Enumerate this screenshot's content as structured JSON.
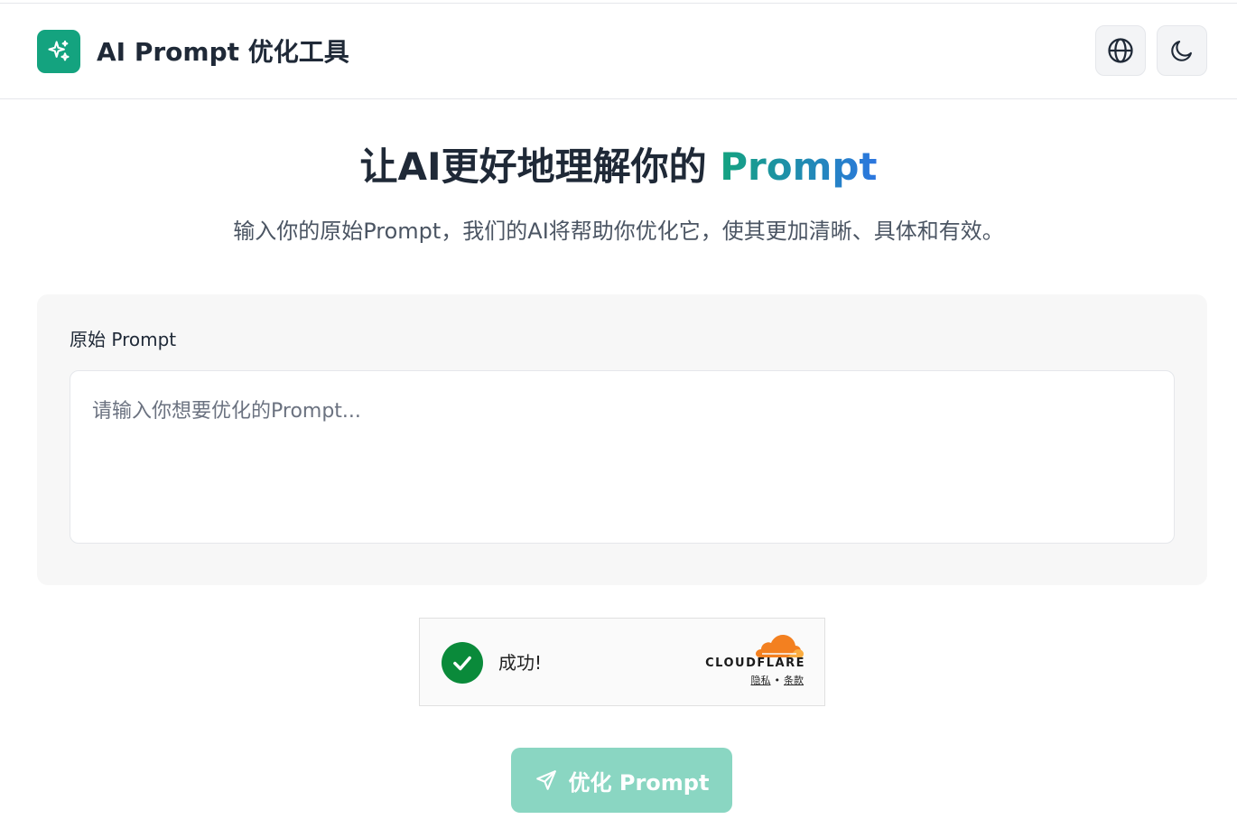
{
  "header": {
    "app_title": "AI Prompt 优化工具",
    "logo_icon": "sparkles-icon",
    "language_button_icon": "globe-icon",
    "theme_button_icon": "moon-icon"
  },
  "hero": {
    "title_main": "让AI更好地理解你的 ",
    "title_accent": "Prompt",
    "subtitle": "输入你的原始Prompt，我们的AI将帮助你优化它，使其更加清晰、具体和有效。"
  },
  "form": {
    "label": "原始 Prompt",
    "input_value": "",
    "input_placeholder": "请输入你想要优化的Prompt..."
  },
  "captcha": {
    "status_text": "成功!",
    "brand": "CLOUDFLARE",
    "privacy_link": "隐私",
    "separator": "•",
    "terms_link": "条款"
  },
  "submit": {
    "icon": "send-icon",
    "label": "优化 Prompt"
  },
  "colors": {
    "brand_green": "#14a37f",
    "accent_blue": "#2c76e0",
    "button_disabled": "#8ad6c2",
    "success_green": "#0a8a3a",
    "cloudflare_orange": "#f38020"
  }
}
